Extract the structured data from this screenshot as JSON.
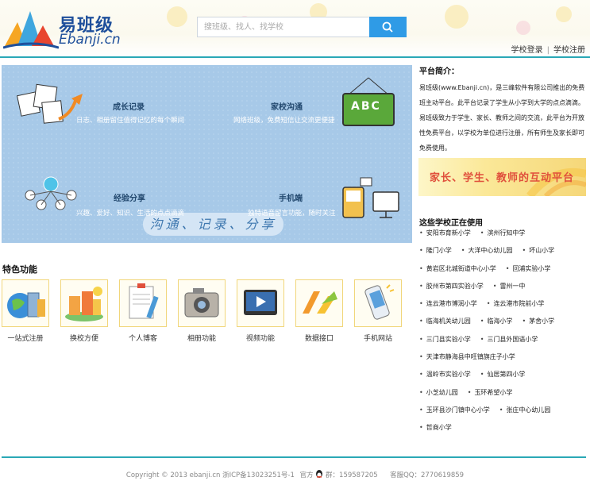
{
  "header": {
    "logo_name": "易班级",
    "logo_domain": "Ebanji.cn",
    "search_placeholder": "搜班级、找人、找学校",
    "login": "学校登录",
    "separator": "|",
    "register": "学校注册"
  },
  "banner": {
    "items": [
      {
        "title": "成长记录",
        "desc": "日志、相册留住值得记忆的每个瞬间"
      },
      {
        "title": "家校沟通",
        "desc": "网络班级，免费短信让交流更便捷"
      },
      {
        "title": "经验分享",
        "desc": "兴趣、爱好、知识、生活的点点滴滴"
      },
      {
        "title": "手机端",
        "desc": "独特语音留言功能，随时关注"
      }
    ],
    "slogan": "沟通、记录、分享",
    "board_text": "ABC"
  },
  "features": {
    "title": "特色功能",
    "items": [
      {
        "label": "一站式注册",
        "icon": "globe-building-icon"
      },
      {
        "label": "换校方便",
        "icon": "school-buildings-icon"
      },
      {
        "label": "个人博客",
        "icon": "notepad-blog-icon"
      },
      {
        "label": "相册功能",
        "icon": "camera-icon"
      },
      {
        "label": "视频功能",
        "icon": "video-player-icon"
      },
      {
        "label": "数据接口",
        "icon": "data-interface-icon"
      },
      {
        "label": "手机网站",
        "icon": "mobile-phone-icon"
      }
    ]
  },
  "sidebar": {
    "intro_title": "平台简介：",
    "intro_text": "易班级(www.Ebanji.cn)，是三峰软件有限公司推出的免费班主动平台。此平台记录了学生从小学到大学的点点滴滴。易班级致力于学生、家长、教师之间的交流，此平台为开放性免费平台，以学校为单位进行注册，所有师生及家长即可免费使用。",
    "promo_text": "家长、学生、教师的互动平台",
    "schools_title": "这些学校正在使用",
    "schools": [
      [
        "安阳市育新小学",
        "滨州行知中学"
      ],
      [
        "隆门小学",
        "大洋中心幼儿园",
        "坏山小学"
      ],
      [
        "黄岩区北城街道中心小学",
        "回浦实验小学"
      ],
      [
        "胶州市第四实验小学",
        "雷州一中"
      ],
      [
        "连云港市博润小学",
        "连云港市院前小学"
      ],
      [
        "临海机关幼儿园",
        "临海小学",
        "茅舍小学"
      ],
      [
        "三门县实验小学",
        "三门县外国语小学"
      ],
      [
        "天津市静海县中旺镇旗庄子小学"
      ],
      [
        "温岭市实验小学",
        "仙居第四小学"
      ],
      [
        "小芝幼儿园",
        "玉环希望小学"
      ],
      [
        "玉环县沙门镇中心小学",
        "张庄中心幼儿园"
      ],
      [
        "哲商小学"
      ]
    ]
  },
  "footer": {
    "copyright": "Copyright © 2013 ebanji.cn 浙ICP备13023251号-1",
    "qq_group_label": "官方",
    "qq_group": "群：159587205",
    "service_qq": "客服QQ：2770619859"
  },
  "colors": {
    "accent_line": "#2aa8b6",
    "search_button": "#2f9be6",
    "banner_bg": "#a7c9e8",
    "brand_blue": "#1e4f9b"
  }
}
